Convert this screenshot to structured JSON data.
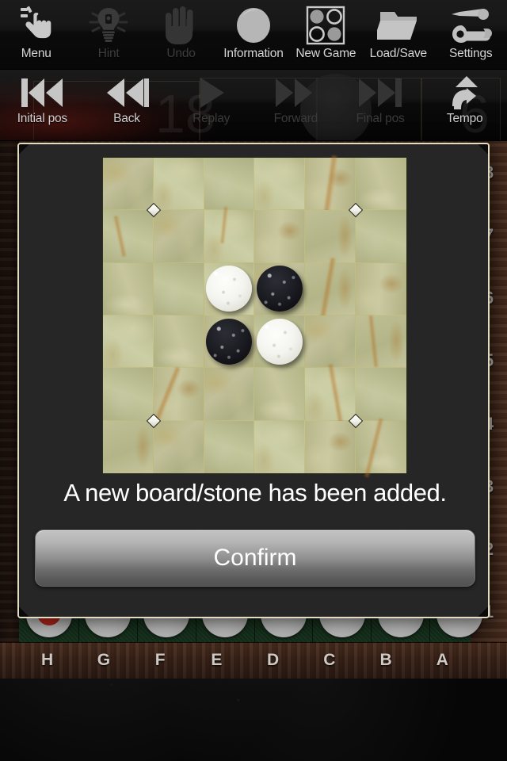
{
  "toolbar_top": {
    "items": [
      {
        "label": "Menu",
        "icon": "pointing-hand-icon",
        "enabled": true
      },
      {
        "label": "Hint",
        "icon": "lightbulb-icon",
        "enabled": false
      },
      {
        "label": "Undo",
        "icon": "open-hand-icon",
        "enabled": false
      },
      {
        "label": "Information",
        "icon": "disc-icon",
        "enabled": true
      },
      {
        "label": "New Game",
        "icon": "othello-grid-icon",
        "enabled": true
      },
      {
        "label": "Load/Save",
        "icon": "folder-icon",
        "enabled": true
      },
      {
        "label": "Settings",
        "icon": "wrench-icon",
        "enabled": true
      }
    ]
  },
  "toolbar_playback": {
    "items": [
      {
        "label": "Initial pos",
        "icon": "skip-back-icon",
        "enabled": true
      },
      {
        "label": "Back",
        "icon": "rewind-icon",
        "enabled": true
      },
      {
        "label": "Replay",
        "icon": "play-icon",
        "enabled": false
      },
      {
        "label": "Forward",
        "icon": "fast-forward-icon",
        "enabled": false
      },
      {
        "label": "Final pos",
        "icon": "skip-forward-icon",
        "enabled": false
      },
      {
        "label": "Tempo",
        "icon": "up-arrow-icon",
        "enabled": true
      }
    ],
    "ghost_numbers": [
      "18",
      "6"
    ]
  },
  "board": {
    "row_labels": [
      "8",
      "7",
      "6",
      "5",
      "4",
      "3",
      "2",
      "1"
    ],
    "col_labels": [
      "H",
      "G",
      "F",
      "E",
      "D",
      "C",
      "B",
      "A"
    ],
    "tray": {
      "slot_count": 8,
      "active_slot_index": 0,
      "active_marker_color": "#c52a22"
    }
  },
  "dialog": {
    "message": "A new board/stone has been added.",
    "confirm_label": "Confirm",
    "border_color": "#e4dcc0",
    "background_color": "#262626",
    "preview_board": {
      "columns": 6,
      "rows": 6,
      "stones": [
        {
          "row": 2,
          "col": 2,
          "color": "white"
        },
        {
          "row": 2,
          "col": 3,
          "color": "black"
        },
        {
          "row": 3,
          "col": 2,
          "color": "black"
        },
        {
          "row": 3,
          "col": 3,
          "color": "white"
        }
      ],
      "markers": [
        {
          "row": 1,
          "col": 1
        },
        {
          "row": 1,
          "col": 5
        },
        {
          "row": 5,
          "col": 1
        },
        {
          "row": 5,
          "col": 5
        }
      ],
      "tile_color": "#bcbb93",
      "grid_line_color": "#c4be78"
    }
  }
}
